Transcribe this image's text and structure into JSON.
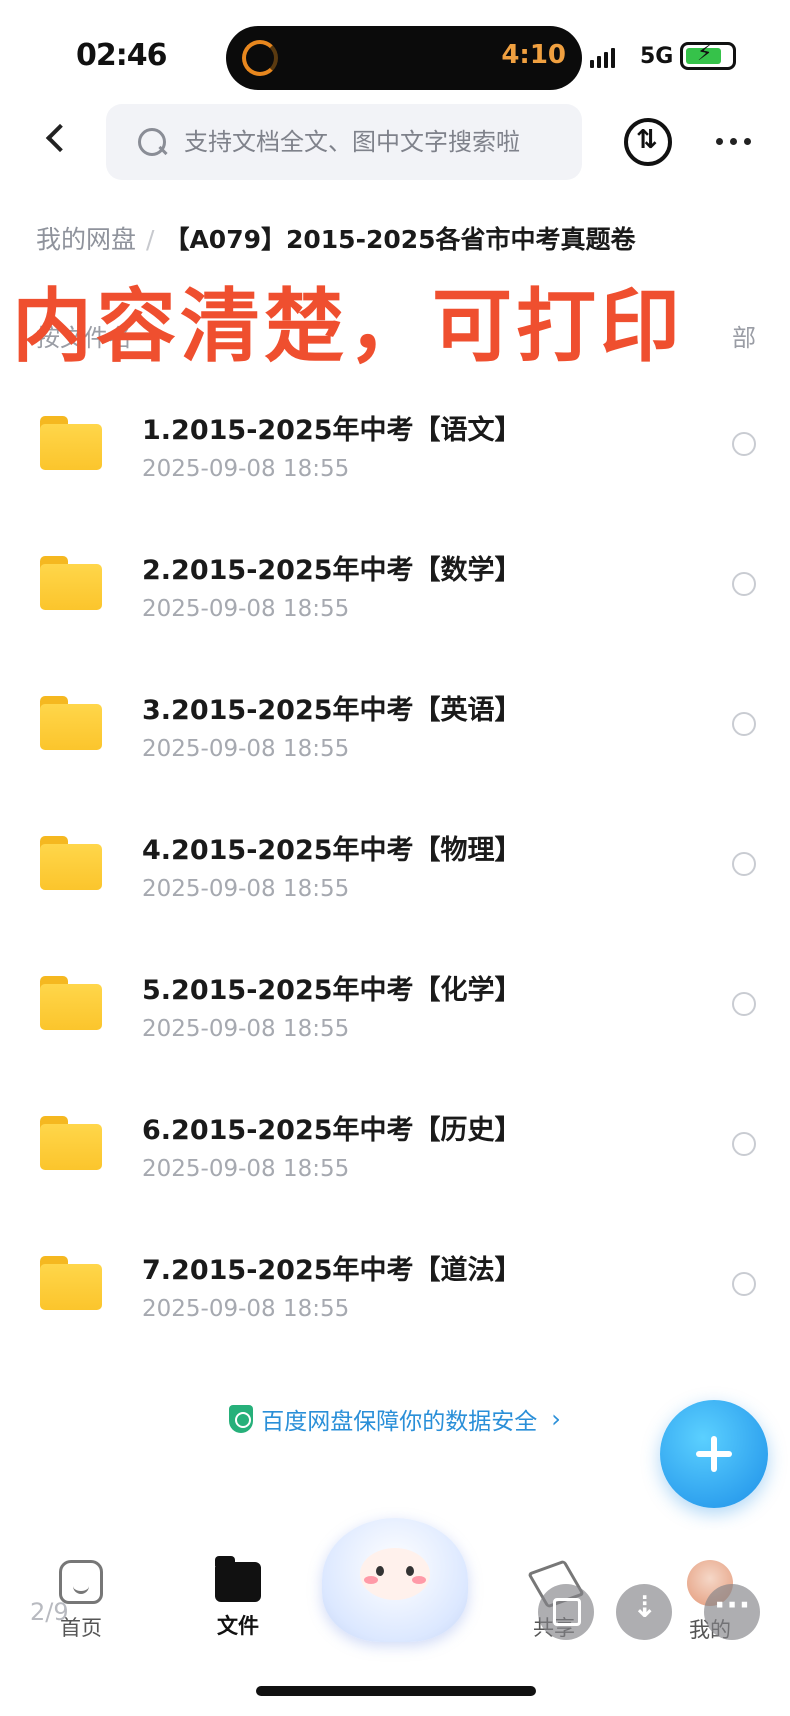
{
  "status_bar": {
    "clock": "02:46",
    "island_time": "4:10",
    "network": "5G"
  },
  "search": {
    "placeholder": "支持文档全文、图中文字搜索啦"
  },
  "breadcrumb": {
    "root": "我的网盘",
    "separator": "/",
    "current": "【A079】2015-2025各省市中考真题卷"
  },
  "sort_row": {
    "label": "按文件名",
    "right": "部"
  },
  "overlay_banner": "内容清楚，可打印",
  "folders": [
    {
      "name": "1.2015-2025年中考【语文】",
      "date": "2025-09-08 18:55"
    },
    {
      "name": "2.2015-2025年中考【数学】",
      "date": "2025-09-08 18:55"
    },
    {
      "name": "3.2015-2025年中考【英语】",
      "date": "2025-09-08 18:55"
    },
    {
      "name": "4.2015-2025年中考【物理】",
      "date": "2025-09-08 18:55"
    },
    {
      "name": "5.2015-2025年中考【化学】",
      "date": "2025-09-08 18:55"
    },
    {
      "name": "6.2015-2025年中考【历史】",
      "date": "2025-09-08 18:55"
    },
    {
      "name": "7.2015-2025年中考【道法】",
      "date": "2025-09-08 18:55"
    }
  ],
  "security_notice": "百度网盘保障你的数据安全",
  "tabbar": {
    "home": "首页",
    "files": "文件",
    "share": "共享",
    "mine": "我的"
  },
  "page_counter": "2/9",
  "colors": {
    "banner_red": "#ef4f2f",
    "folder_yellow": "#fbc52c",
    "fab_blue": "#1d8fe8",
    "security_blue": "#2a8fd8"
  }
}
